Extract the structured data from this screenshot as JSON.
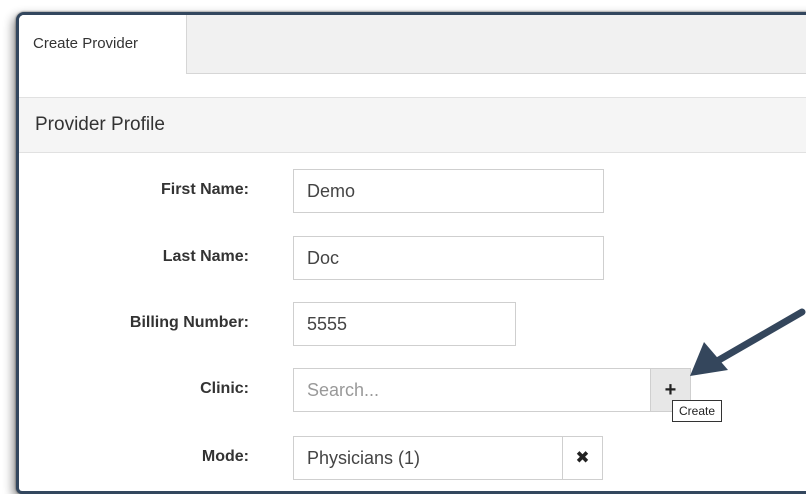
{
  "tabs": [
    {
      "label": "Create Provider",
      "active": true
    }
  ],
  "section": {
    "title": "Provider Profile"
  },
  "form": {
    "first_name": {
      "label": "First Name:",
      "value": "Demo"
    },
    "last_name": {
      "label": "Last Name:",
      "value": "Doc"
    },
    "billing_number": {
      "label": "Billing Number:",
      "value": "5555"
    },
    "clinic": {
      "label": "Clinic:",
      "placeholder": "Search...",
      "add_icon": "plus-icon"
    },
    "mode": {
      "label": "Mode:",
      "value": "Physicians (1)",
      "clear_icon": "close-icon"
    }
  },
  "tooltip": {
    "text": "Create"
  },
  "colors": {
    "frame": "#33475e",
    "arrow": "#34465c",
    "header_bg": "#f5f5f5",
    "tabbar_bg": "#f1f1f1"
  }
}
